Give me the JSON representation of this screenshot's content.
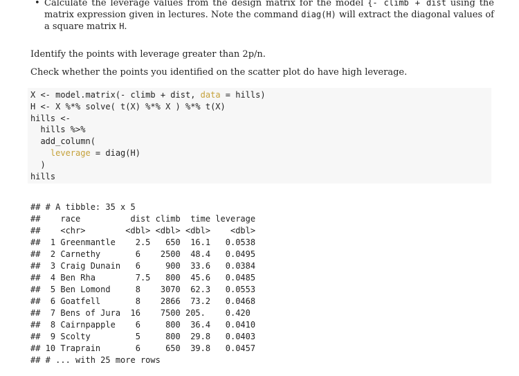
{
  "instructions": {
    "bullet": {
      "t1": "Calculate the leverage values from the design matrix for the model ",
      "c1": "{- climb + dist",
      "t2": " using the matrix expression given in lectures. Note the command ",
      "c2": "diag(H)",
      "t3": " will extract the diagonal values of a square matrix ",
      "c3": "H",
      "t4": "."
    },
    "p1": "Identify the points with leverage greater than 2p/n.",
    "p2": "Check whether the points you identified on the scatter plot do have high leverage."
  },
  "code": {
    "l1a": "X <- model.matrix(- climb + dist, ",
    "l1arg": "data",
    "l1b": " = hills)",
    "l2": "H <- X %*% solve( t(X) %*% X ) %*% t(X)",
    "l3": "hills <-",
    "l4": "  hills %>%",
    "l5": "  add_column(",
    "l6arg": "    leverage",
    "l6b": " = diag(H)",
    "l7": "  )",
    "l8": "hills"
  },
  "output": {
    "lines": [
      "## # A tibble: 35 x 5",
      "##    race          dist climb  time leverage",
      "##    <chr>        <dbl> <dbl> <dbl>    <dbl>",
      "##  1 Greenmantle    2.5   650  16.1   0.0538",
      "##  2 Carnethy       6    2500  48.4   0.0495",
      "##  3 Craig Dunain   6     900  33.6   0.0384",
      "##  4 Ben Rha        7.5   800  45.6   0.0485",
      "##  5 Ben Lomond     8    3070  62.3   0.0553",
      "##  6 Goatfell       8    2866  73.2   0.0468",
      "##  7 Bens of Jura  16    7500 205.    0.420",
      "##  8 Cairnpapple    6     800  36.4   0.0410",
      "##  9 Scolty         5     800  29.8   0.0403",
      "## 10 Traprain       6     650  39.8   0.0457",
      "## # ... with 25 more rows"
    ]
  }
}
